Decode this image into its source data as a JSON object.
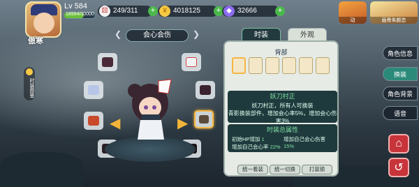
{
  "player": {
    "level": "Lv 584",
    "exp_text": "18994/30000",
    "exp_fraction": 0.63,
    "name": "傲寒"
  },
  "resources": [
    {
      "icon": "dice-icon",
      "value": "249/311"
    },
    {
      "icon": "gold-coin-icon",
      "value": "4018125"
    },
    {
      "icon": "diamond-icon",
      "value": "32666"
    }
  ],
  "events": [
    {
      "label": "动",
      "name": "event-motion"
    },
    {
      "label": "画骨朱颜恋",
      "name": "event-promo"
    }
  ],
  "side_tag": "时装图鉴",
  "center_tab": "会心会伤",
  "panel": {
    "tabs": [
      "时装",
      "外观"
    ],
    "section_back": "背部",
    "item_name": "妖刀村正",
    "desc_lines": [
      "妖刀村正，所有人可换装",
      "青影换装部件，增加会心率5%，增加会心伤害3%"
    ],
    "total_header": "时装总属性",
    "stats": [
      {
        "label": "初始HP增加",
        "value": "1"
      },
      {
        "label": "增加自己会心伤害",
        "value": "15%"
      },
      {
        "label": "增加自己会心率",
        "value": "22%"
      }
    ],
    "buttons": [
      "统一着装",
      "统一切换",
      "打装锁"
    ]
  },
  "right_menu": [
    "角色信息",
    "换装",
    "角色背景",
    "语音"
  ],
  "colors": {
    "accent": "#f6b642",
    "active_tab": "#2b8a7a",
    "panel_bg": "#e6ebe6",
    "dark_panel": "#1f3a3d",
    "green_text": "#7fe0a4"
  }
}
